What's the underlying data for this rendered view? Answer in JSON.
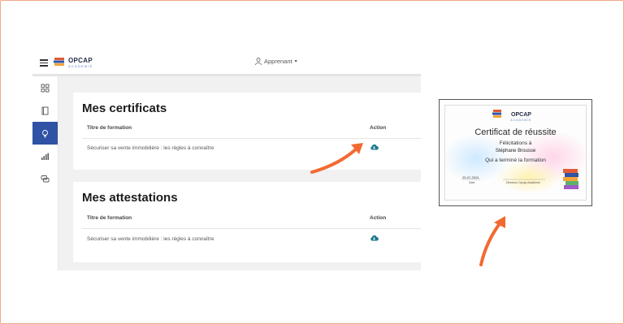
{
  "header": {
    "brand_name": "OPCAP",
    "brand_sub": "ACADEMIE",
    "user_label": "Apprenant",
    "user_caret": "▾"
  },
  "sidebar": {
    "items": [
      {
        "icon": "grid-icon",
        "active": false
      },
      {
        "icon": "book-icon",
        "active": false
      },
      {
        "icon": "lightbulb-icon",
        "active": true
      },
      {
        "icon": "bar-chart-icon",
        "active": false
      },
      {
        "icon": "chat-icon",
        "active": false
      }
    ]
  },
  "certificates": {
    "title": "Mes certificats",
    "col_formation": "Titre de formation",
    "col_action": "Action",
    "rows": [
      {
        "formation": "Sécuriser sa vente immobilière : les règles à connaître",
        "action_icon": "cloud-download-icon"
      }
    ]
  },
  "attestations": {
    "title": "Mes attestations",
    "col_formation": "Titre de formation",
    "col_action": "Action",
    "rows": [
      {
        "formation": "Sécuriser sa vente immobilière : les règles à connaître",
        "action_icon": "cloud-download-icon"
      }
    ]
  },
  "certificate_preview": {
    "brand_name": "OPCAP",
    "brand_sub": "ACADEMIE",
    "title": "Certificat de réussite",
    "congrats": "Félicitations à",
    "recipient": "Stéphane Brousse",
    "completed": "Qui a terminé la formation",
    "date_value": "25-07-2024",
    "date_label": "Date",
    "director": "Directeur Opcap Académie"
  },
  "colors": {
    "accent": "#2f52a4",
    "download_icon": "#1f7a8c",
    "arrow": "#f26a32",
    "frame_border": "#f0a88a"
  }
}
